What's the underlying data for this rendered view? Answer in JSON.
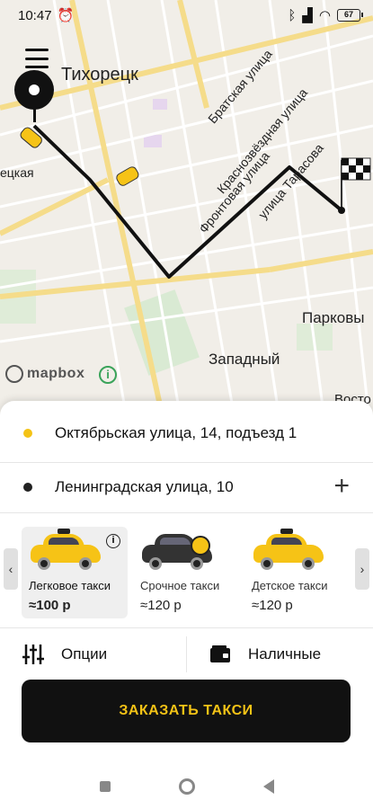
{
  "status_bar": {
    "time": "10:47",
    "battery": "67"
  },
  "map": {
    "city": "Тихорецк",
    "labels": {
      "west": "ецкая",
      "street1": "Братская улица",
      "street2": "Краснозвёздная улица",
      "street3": "Фронтовая улица",
      "street4": "улица Тарасова",
      "park": "Парковы",
      "west_district": "Западный",
      "east_partial": "Восто"
    },
    "attribution": "mapbox"
  },
  "route": {
    "from": "Октябрьская улица, 14, подъезд 1",
    "to": "Ленинградская улица, 10"
  },
  "tariffs": [
    {
      "name": "Легковое такси",
      "price": "≈100 р",
      "active": true
    },
    {
      "name": "Срочное такси",
      "price": "≈120 р",
      "active": false
    },
    {
      "name": "Детское такси",
      "price": "≈120 р",
      "active": false
    }
  ],
  "options": {
    "options_label": "Опции",
    "payment_label": "Наличные"
  },
  "order_button": "ЗАКАЗАТЬ ТАКСИ",
  "colors": {
    "accent": "#f4c316",
    "dark": "#111111"
  }
}
